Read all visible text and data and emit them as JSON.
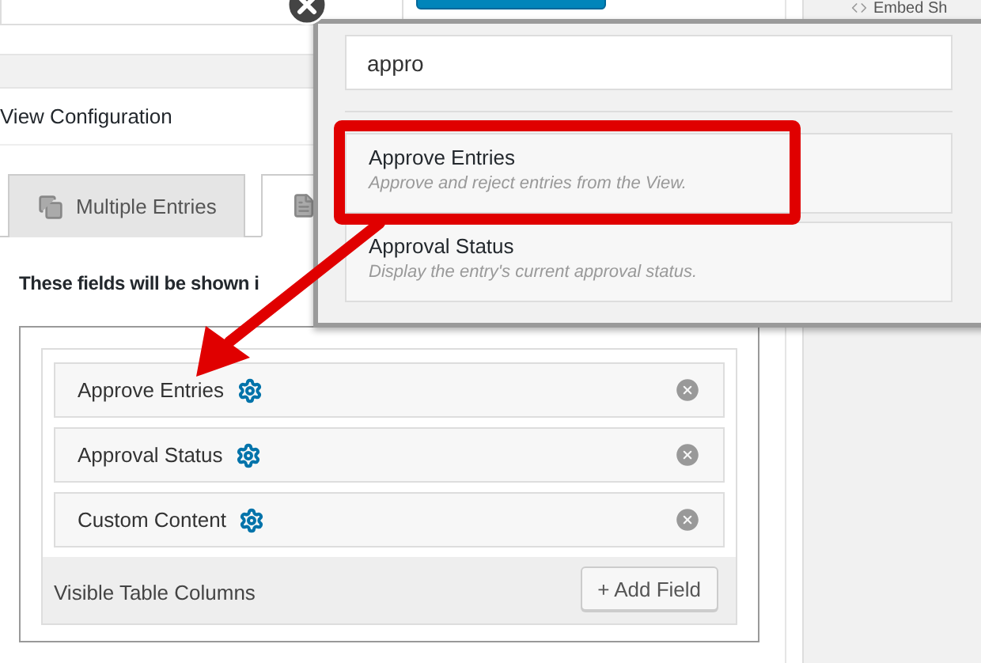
{
  "sidebar": {
    "item": "Embed Sh"
  },
  "section": {
    "title": "View Configuration"
  },
  "tabs": [
    {
      "label": "Multiple Entries",
      "kind": "multiple",
      "selected": false
    },
    {
      "kind": "single",
      "selected": true
    }
  ],
  "instructions": "These fields will be shown i",
  "fields": [
    {
      "label": "Approve Entries"
    },
    {
      "label": "Approval Status"
    },
    {
      "label": "Custom Content"
    }
  ],
  "area": {
    "label": "Visible Table Columns",
    "button": "+ Add Field"
  },
  "picker": {
    "search": "appro",
    "results": [
      {
        "title": "Approve Entries",
        "description": "Approve and reject entries from the View.",
        "highlighted": true
      },
      {
        "title": "Approval Status",
        "description": "Display the entry's current approval status.",
        "highlighted": false
      }
    ]
  }
}
